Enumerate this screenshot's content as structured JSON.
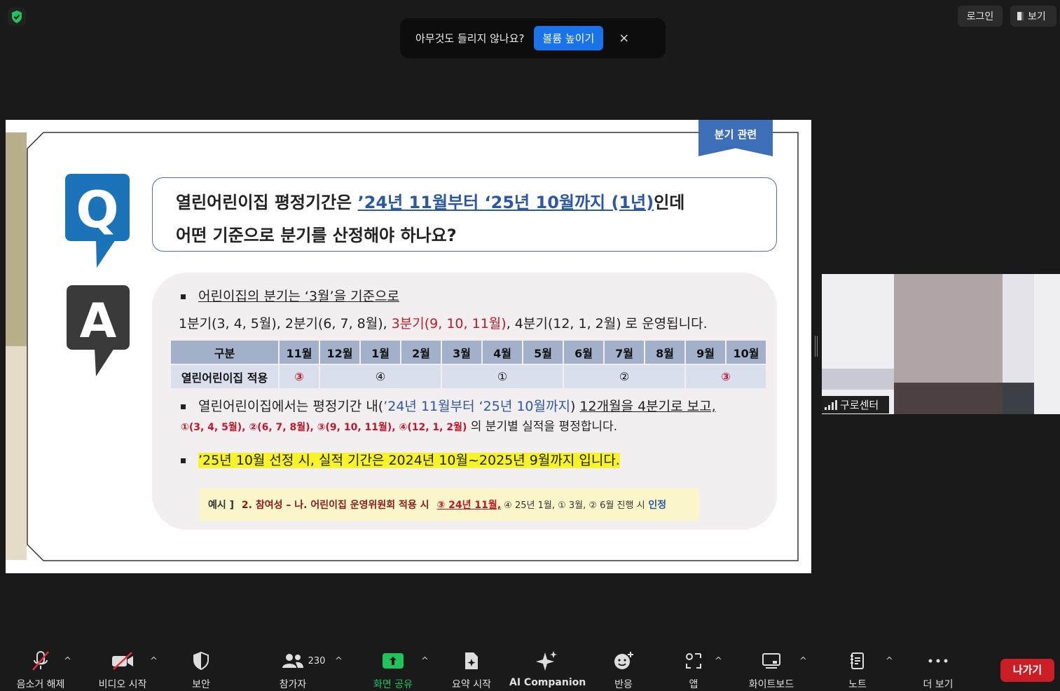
{
  "top": {
    "login_label": "로그인",
    "view_label": "보기"
  },
  "banner": {
    "message": "아무것도 들리지 않나요?",
    "button": "볼륨 높이기",
    "close": "×"
  },
  "slide": {
    "tag": "분기 관련",
    "q_letter": "Q",
    "a_letter": "A",
    "question_line1_a": "열린어린이집 평정기간은 ",
    "question_line1_hl": "’24년 11월부터 ‘25년 10월까지 (1년)",
    "question_line1_b": "인데",
    "question_line2": "어떤 기준으로 분기를 산정해야 하나요?",
    "answer1": "어린이집의 분기는 ‘3월’을 기준으로",
    "answer2_a": "1분기(3, 4, 5월), 2분기(6, 7, 8월), ",
    "answer2_red": "3분기(9, 10, 11월)",
    "answer2_b": ", 4분기(12, 1, 2월) 로 운영됩니다.",
    "table_header": [
      "구분",
      "11월",
      "12월",
      "1월",
      "2월",
      "3월",
      "4월",
      "5월",
      "6월",
      "7월",
      "8월",
      "9월",
      "10월"
    ],
    "table_row_label": "열린어린이집 적용",
    "table_row_cells": [
      "③",
      "④",
      "①",
      "②",
      "③"
    ],
    "bullet2_a": "열린어린이집에서는 평정기간 내(",
    "bullet2_blue": "’24년 11월부터 ‘25년 10월까지",
    "bullet2_b": ") ",
    "bullet2_u": "12개월을 4분기로 보고,",
    "bullet2_line2_red": "①(3, 4, 5월), ②(6, 7, 8월), ③(9, 10, 11월), ④(12, 1, 2월)",
    "bullet2_line2_b": " 의 분기별 실적을 평정합니다.",
    "bullet3": "’25년 10월 선정 시, 실적 기간은 2024년 10월~2025년 9월까지 입니다.",
    "example_label": "예시 ]",
    "example_a": "2. 참여성 – 나. 어린이집 운영위원회 적용 시",
    "example_red": "③ 24년 11월,",
    "example_b": " ④ 25년 1월, ① 3월, ② 6월 진행 시",
    "example_blue": " 인정"
  },
  "video": {
    "name": "구로센터"
  },
  "toolbar": {
    "unmute": "음소거 해제",
    "start_video": "비디오 시작",
    "security": "보안",
    "participants": "참가자",
    "participants_count": "230",
    "share": "화면 공유",
    "summary": "요약 시작",
    "ai": "AI Companion",
    "reactions": "반응",
    "apps": "앱",
    "whiteboard": "화이트보드",
    "notes": "노트",
    "more": "더 보기",
    "leave": "나가기"
  },
  "colors": {
    "accent_blue": "#1a73e8",
    "share_green": "#21c45a",
    "leave_red": "#c91e26",
    "slide_red": "#c0172b",
    "slide_blue": "#2b57a3"
  }
}
